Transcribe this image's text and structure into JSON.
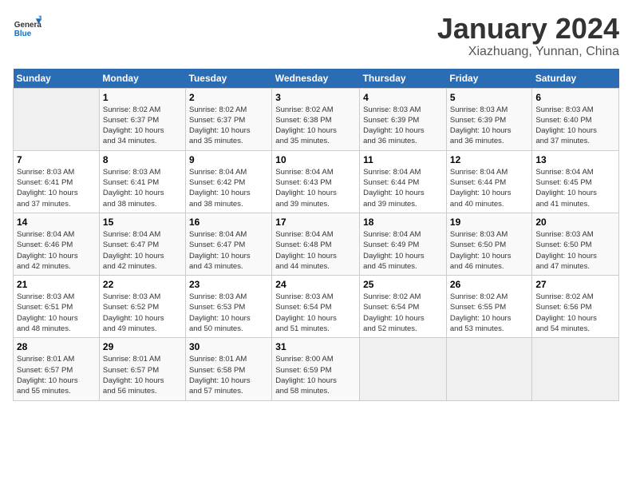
{
  "logo": {
    "general": "General",
    "blue": "Blue"
  },
  "title": "January 2024",
  "subtitle": "Xiazhuang, Yunnan, China",
  "days_of_week": [
    "Sunday",
    "Monday",
    "Tuesday",
    "Wednesday",
    "Thursday",
    "Friday",
    "Saturday"
  ],
  "weeks": [
    [
      {
        "day": "",
        "info": ""
      },
      {
        "day": "1",
        "info": "Sunrise: 8:02 AM\nSunset: 6:37 PM\nDaylight: 10 hours\nand 34 minutes."
      },
      {
        "day": "2",
        "info": "Sunrise: 8:02 AM\nSunset: 6:37 PM\nDaylight: 10 hours\nand 35 minutes."
      },
      {
        "day": "3",
        "info": "Sunrise: 8:02 AM\nSunset: 6:38 PM\nDaylight: 10 hours\nand 35 minutes."
      },
      {
        "day": "4",
        "info": "Sunrise: 8:03 AM\nSunset: 6:39 PM\nDaylight: 10 hours\nand 36 minutes."
      },
      {
        "day": "5",
        "info": "Sunrise: 8:03 AM\nSunset: 6:39 PM\nDaylight: 10 hours\nand 36 minutes."
      },
      {
        "day": "6",
        "info": "Sunrise: 8:03 AM\nSunset: 6:40 PM\nDaylight: 10 hours\nand 37 minutes."
      }
    ],
    [
      {
        "day": "7",
        "info": "Sunrise: 8:03 AM\nSunset: 6:41 PM\nDaylight: 10 hours\nand 37 minutes."
      },
      {
        "day": "8",
        "info": "Sunrise: 8:03 AM\nSunset: 6:41 PM\nDaylight: 10 hours\nand 38 minutes."
      },
      {
        "day": "9",
        "info": "Sunrise: 8:04 AM\nSunset: 6:42 PM\nDaylight: 10 hours\nand 38 minutes."
      },
      {
        "day": "10",
        "info": "Sunrise: 8:04 AM\nSunset: 6:43 PM\nDaylight: 10 hours\nand 39 minutes."
      },
      {
        "day": "11",
        "info": "Sunrise: 8:04 AM\nSunset: 6:44 PM\nDaylight: 10 hours\nand 39 minutes."
      },
      {
        "day": "12",
        "info": "Sunrise: 8:04 AM\nSunset: 6:44 PM\nDaylight: 10 hours\nand 40 minutes."
      },
      {
        "day": "13",
        "info": "Sunrise: 8:04 AM\nSunset: 6:45 PM\nDaylight: 10 hours\nand 41 minutes."
      }
    ],
    [
      {
        "day": "14",
        "info": "Sunrise: 8:04 AM\nSunset: 6:46 PM\nDaylight: 10 hours\nand 42 minutes."
      },
      {
        "day": "15",
        "info": "Sunrise: 8:04 AM\nSunset: 6:47 PM\nDaylight: 10 hours\nand 42 minutes."
      },
      {
        "day": "16",
        "info": "Sunrise: 8:04 AM\nSunset: 6:47 PM\nDaylight: 10 hours\nand 43 minutes."
      },
      {
        "day": "17",
        "info": "Sunrise: 8:04 AM\nSunset: 6:48 PM\nDaylight: 10 hours\nand 44 minutes."
      },
      {
        "day": "18",
        "info": "Sunrise: 8:04 AM\nSunset: 6:49 PM\nDaylight: 10 hours\nand 45 minutes."
      },
      {
        "day": "19",
        "info": "Sunrise: 8:03 AM\nSunset: 6:50 PM\nDaylight: 10 hours\nand 46 minutes."
      },
      {
        "day": "20",
        "info": "Sunrise: 8:03 AM\nSunset: 6:50 PM\nDaylight: 10 hours\nand 47 minutes."
      }
    ],
    [
      {
        "day": "21",
        "info": "Sunrise: 8:03 AM\nSunset: 6:51 PM\nDaylight: 10 hours\nand 48 minutes."
      },
      {
        "day": "22",
        "info": "Sunrise: 8:03 AM\nSunset: 6:52 PM\nDaylight: 10 hours\nand 49 minutes."
      },
      {
        "day": "23",
        "info": "Sunrise: 8:03 AM\nSunset: 6:53 PM\nDaylight: 10 hours\nand 50 minutes."
      },
      {
        "day": "24",
        "info": "Sunrise: 8:03 AM\nSunset: 6:54 PM\nDaylight: 10 hours\nand 51 minutes."
      },
      {
        "day": "25",
        "info": "Sunrise: 8:02 AM\nSunset: 6:54 PM\nDaylight: 10 hours\nand 52 minutes."
      },
      {
        "day": "26",
        "info": "Sunrise: 8:02 AM\nSunset: 6:55 PM\nDaylight: 10 hours\nand 53 minutes."
      },
      {
        "day": "27",
        "info": "Sunrise: 8:02 AM\nSunset: 6:56 PM\nDaylight: 10 hours\nand 54 minutes."
      }
    ],
    [
      {
        "day": "28",
        "info": "Sunrise: 8:01 AM\nSunset: 6:57 PM\nDaylight: 10 hours\nand 55 minutes."
      },
      {
        "day": "29",
        "info": "Sunrise: 8:01 AM\nSunset: 6:57 PM\nDaylight: 10 hours\nand 56 minutes."
      },
      {
        "day": "30",
        "info": "Sunrise: 8:01 AM\nSunset: 6:58 PM\nDaylight: 10 hours\nand 57 minutes."
      },
      {
        "day": "31",
        "info": "Sunrise: 8:00 AM\nSunset: 6:59 PM\nDaylight: 10 hours\nand 58 minutes."
      },
      {
        "day": "",
        "info": ""
      },
      {
        "day": "",
        "info": ""
      },
      {
        "day": "",
        "info": ""
      }
    ]
  ]
}
